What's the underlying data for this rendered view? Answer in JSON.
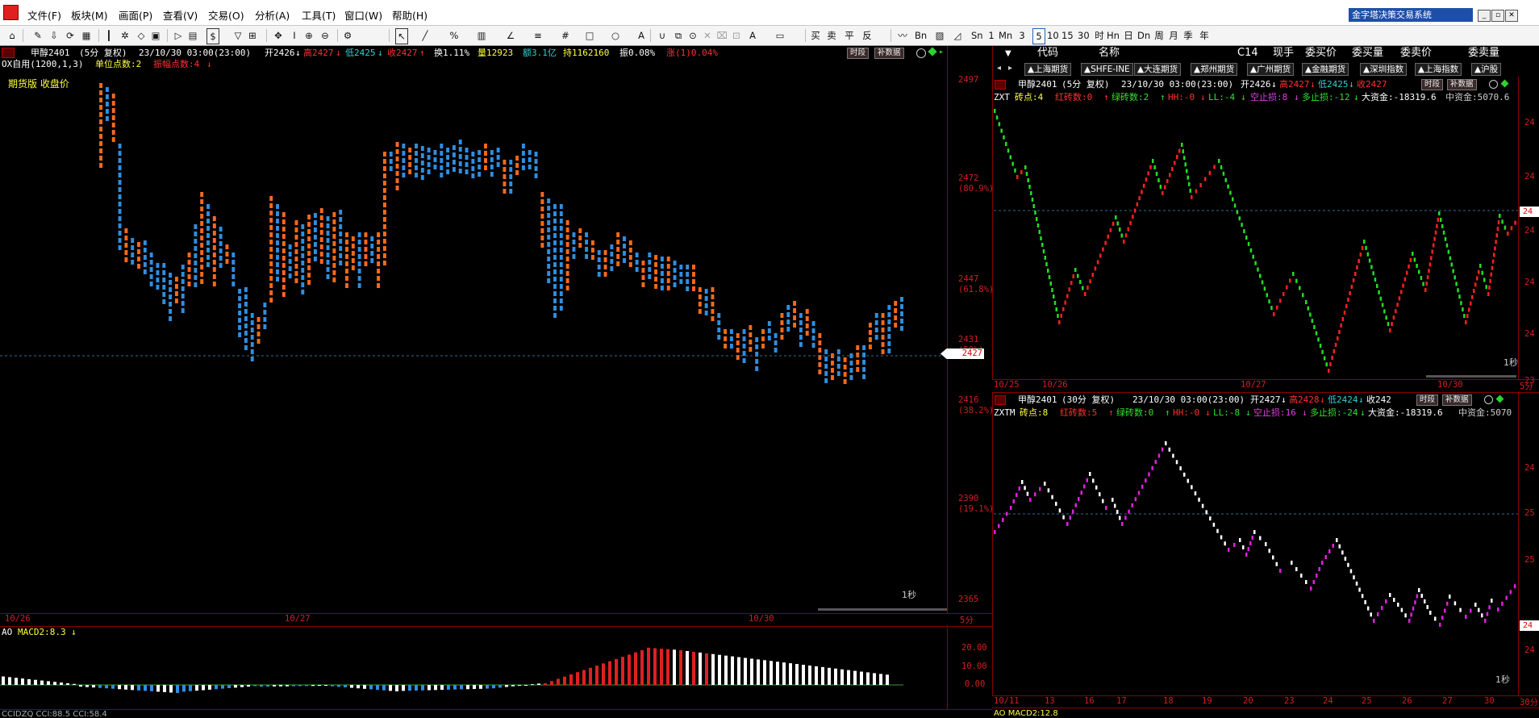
{
  "menu": {
    "items": [
      "文件(F)",
      "板块(M)",
      "画面(P)",
      "查看(V)",
      "交易(O)",
      "分析(A)",
      "工具(T)",
      "窗口(W)",
      "帮助(H)"
    ],
    "app_title": "金字塔决策交易系统"
  },
  "toolbar": {
    "period_labels": [
      "Sn",
      "1",
      "Mn",
      "3",
      "5",
      "10",
      "15",
      "30",
      "时",
      "Hn",
      "日",
      "Dn",
      "周",
      "月",
      "季",
      "年"
    ],
    "active_period": "5",
    "draw_labels": [
      "买",
      "卖",
      "平",
      "反"
    ]
  },
  "main_chart": {
    "header": {
      "name": "甲醇2401",
      "period": "(5分 复权)",
      "time": "23/10/30 03:00(23:00)",
      "open": "开2426",
      "open_arrow": "↓",
      "high": "高2427",
      "high_arrow": "↓",
      "low": "低2425",
      "low_arrow": "↓",
      "close": "收2427",
      "close_arrow": "↑",
      "turnover_rate": "换1.11%",
      "volume": "量12923",
      "amount": "额3.1亿",
      "open_interest": "持1162160",
      "amplitude": "振0.08%",
      "change": "涨(1)0.04%"
    },
    "indicator_line": {
      "name": "OX自用(1200,1,3)",
      "unit": "单位点数:2",
      "rev": "振幅点数:4",
      "rev_arrow": "↓"
    },
    "price_type": "期货版 收盘价",
    "buttons": [
      "时段",
      "补数据"
    ],
    "refresh": "1秒",
    "period_badge": "5分",
    "price_labels": [
      "2497",
      "2472",
      "(80.9%)",
      "2447",
      "(61.8%)",
      "2431",
      "(50%)",
      "2416",
      "(38.2%)",
      "2390",
      "(19.1%)",
      "2365"
    ],
    "current_price": "2427",
    "date_labels": [
      "10/26",
      "10/27",
      "10/30"
    ]
  },
  "sub_indicator": {
    "name": "AO",
    "value": "MACD2:8.3",
    "arrow": "↓",
    "axis_labels": [
      "20.00",
      "10.00",
      "0.00"
    ]
  },
  "bottom_indicator": {
    "text": "CCIDZQ CCI:88.5 CCI:58.4"
  },
  "quote_table": {
    "headers": [
      "代码",
      "名称",
      "C14",
      "现手",
      "委买价",
      "委买量",
      "委卖价",
      "委卖量"
    ],
    "tabs": [
      "▲上海期货",
      "▲SHFE-INE",
      "▲大连期货",
      "▲郑州期货",
      "▲广州期货",
      "▲金融期货",
      "▲深圳指数",
      "▲上海指数",
      "▲沪股"
    ]
  },
  "zxt_chart": {
    "header": {
      "name": "甲醇2401",
      "period": "(5分 复权)",
      "time": "23/10/30 03:00(23:00)",
      "open": "开2426",
      "open_arrow": "↓",
      "high": "高2427",
      "high_arrow": "↓",
      "low": "低2425",
      "low_arrow": "↓",
      "close": "收2427"
    },
    "indicator": {
      "name": "ZXT",
      "bricks": "砖点:4",
      "red": "红砖数:0",
      "red_arrow": "↑",
      "green": "绿砖数:2",
      "green_arrow": "↑",
      "hh": "HH:-0",
      "hh_arrow": "↓",
      "ll": "LL:-4",
      "ll_arrow": "↓",
      "short_stop": "空止损:8",
      "short_arrow": "↓",
      "long_stop": "多止损:-12",
      "long_arrow": "↓",
      "big_fund": "大资金:-18319.6",
      "mid_fund": "中资金:5070.6"
    },
    "buttons": [
      "时段",
      "补数据"
    ],
    "refresh": "1秒",
    "date_labels": [
      "10/25",
      "10/26",
      "10/27",
      "10/30"
    ],
    "price_labels": [
      "24",
      "24",
      "24",
      "24",
      "24",
      "23"
    ],
    "current_price": "24",
    "right_corner": "5分"
  },
  "zxtm_chart": {
    "header": {
      "name": "甲醇2401",
      "period": "(30分 复权)",
      "time": "23/10/30 03:00(23:00)",
      "open": "开2427",
      "open_arrow": "↓",
      "high": "高2428",
      "high_arrow": "↓",
      "low": "低2424",
      "low_arrow": "↓",
      "close": "收242"
    },
    "indicator": {
      "name": "ZXTM",
      "bricks": "砖点:8",
      "red": "红砖数:5",
      "red_arrow": "↑",
      "green": "绿砖数:0",
      "green_arrow": "↑",
      "hh": "HH:-0",
      "hh_arrow": "↓",
      "ll": "LL:-8",
      "ll_arrow": "↓",
      "short_stop": "空止损:16",
      "short_arrow": "↓",
      "long_stop": "多止损:-24",
      "long_arrow": "↓",
      "big_fund": "大资金:-18319.6",
      "mid_fund": "中资金:5070"
    },
    "buttons": [
      "时段",
      "补数据"
    ],
    "refresh": "1秒",
    "date_labels": [
      "10/11",
      "13",
      "16",
      "17",
      "18",
      "19",
      "20",
      "23",
      "24",
      "25",
      "26",
      "27",
      "30"
    ],
    "price_labels": [
      "24",
      "25",
      "25",
      "24",
      "24"
    ],
    "current_price": "24",
    "right_corner": "30分",
    "sub_text": "AO MACD2:12.8"
  },
  "colors": {
    "up": "#ff6a1a",
    "down": "#2f8fe0",
    "axis": "#d02020",
    "zxt_up": "#ff2020",
    "zxt_down": "#20e020",
    "zxtm_up": "#e020e0",
    "zxtm_down": "#ffffff"
  }
}
